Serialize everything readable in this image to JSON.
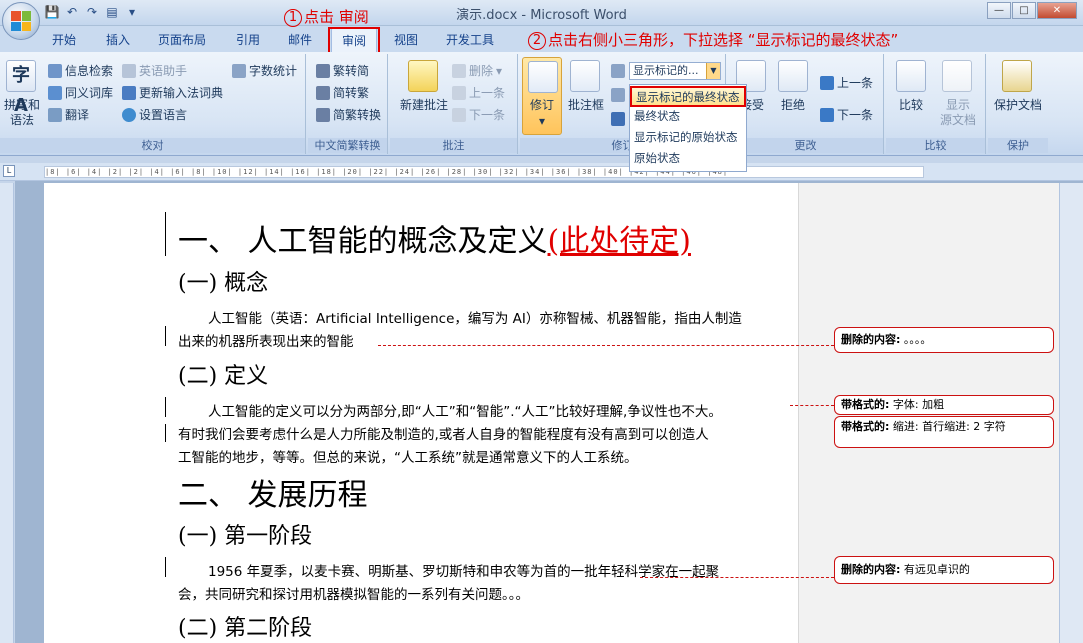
{
  "window": {
    "title": "演示.docx - Microsoft Word",
    "controls": {
      "minimize": "—",
      "maximize": "□",
      "close": "✕"
    }
  },
  "tabs": [
    "开始",
    "插入",
    "页面布局",
    "引用",
    "邮件",
    "审阅",
    "视图",
    "开发工具"
  ],
  "active_tab": "审阅",
  "annotations": {
    "step1_num": "1",
    "step1": "点击 审阅",
    "step2_num": "2",
    "step2": "点击右侧小三角形，下拉选择 “显示标记的最终状态”"
  },
  "ribbon": {
    "proofing": {
      "label": "校对",
      "spelling": "拼写和\n语法",
      "research": "信息检索",
      "thesaurus": "同义词库",
      "translate": "翻译",
      "english_assistant": "英语助手",
      "update_ime": "更新输入法词典",
      "set_language": "设置语言",
      "word_count": "字数统计"
    },
    "chinese": {
      "label": "中文简繁转换",
      "to_simplified": "繁转简",
      "to_traditional": "简转繁",
      "convert": "简繁转换"
    },
    "comments": {
      "label": "批注",
      "new": "新建批注",
      "delete": "删除",
      "prev": "上一条",
      "next": "下一条"
    },
    "tracking": {
      "label": "修订",
      "track": "修订",
      "balloons": "批注框",
      "display_value": "显示标记的...",
      "dropdown": [
        "显示标记的最终状态",
        "最终状态",
        "显示标记的原始状态",
        "原始状态"
      ]
    },
    "changes": {
      "label": "更改",
      "accept": "接受",
      "reject": "拒绝",
      "prev": "上一条",
      "next": "下一条"
    },
    "compare": {
      "label": "比较",
      "compare": "比较",
      "show_source": "显示\n源文档"
    },
    "protect": {
      "label": "保护",
      "protect_doc": "保护文档"
    }
  },
  "ruler_text": "|8| |6| |4| |2|  |2| |4| |6| |8| |10| |12| |14| |16| |18| |20| |22| |24| |26| |28| |30| |32| |34| |36| |38| |40| |42| |44| |46| |48|",
  "document": {
    "h1_a": "一、  人工智能的概念及定义",
    "h1_a_inserted": "(此处待定)",
    "h2_concept": "(一) 概念",
    "p1_line1": "人工智能（英语：Artificial Intelligence，编写为 AI）亦称智械、机器智能，指由人制造",
    "p1_line2": "出来的机器所表现出来的智能",
    "h2_definition": "(二) 定义",
    "p2_line1": "人工智能的定义可以分为两部分,即“人工”和“智能”.“人工”比较好理解,争议性也不大。",
    "p2_line2": "有时我们会要考虑什么是人力所能及制造的,或者人自身的智能程度有没有高到可以创造人",
    "p2_line3": "工智能的地步，等等。但总的来说，“人工系统”就是通常意义下的人工系统。",
    "h1_b": "二、  发展历程",
    "h2_stage1": "(一) 第一阶段",
    "p3_line1": "1956 年夏季，以麦卡赛、明斯基、罗切斯特和申农等为首的一批年轻科学家在一起聚",
    "p3_line2": "会，共同研究和探讨用机器模拟智能的一系列有关问题。。。",
    "h2_stage2": "(二) 第二阶段"
  },
  "balloons": [
    {
      "label": "删除的内容:",
      "text": "。。。。"
    },
    {
      "label": "带格式的:",
      "text": "字体: 加粗"
    },
    {
      "label": "带格式的:",
      "text": "缩进: 首行缩进: 2 字符"
    },
    {
      "label": "删除的内容:",
      "text": "有远见卓识的"
    }
  ]
}
